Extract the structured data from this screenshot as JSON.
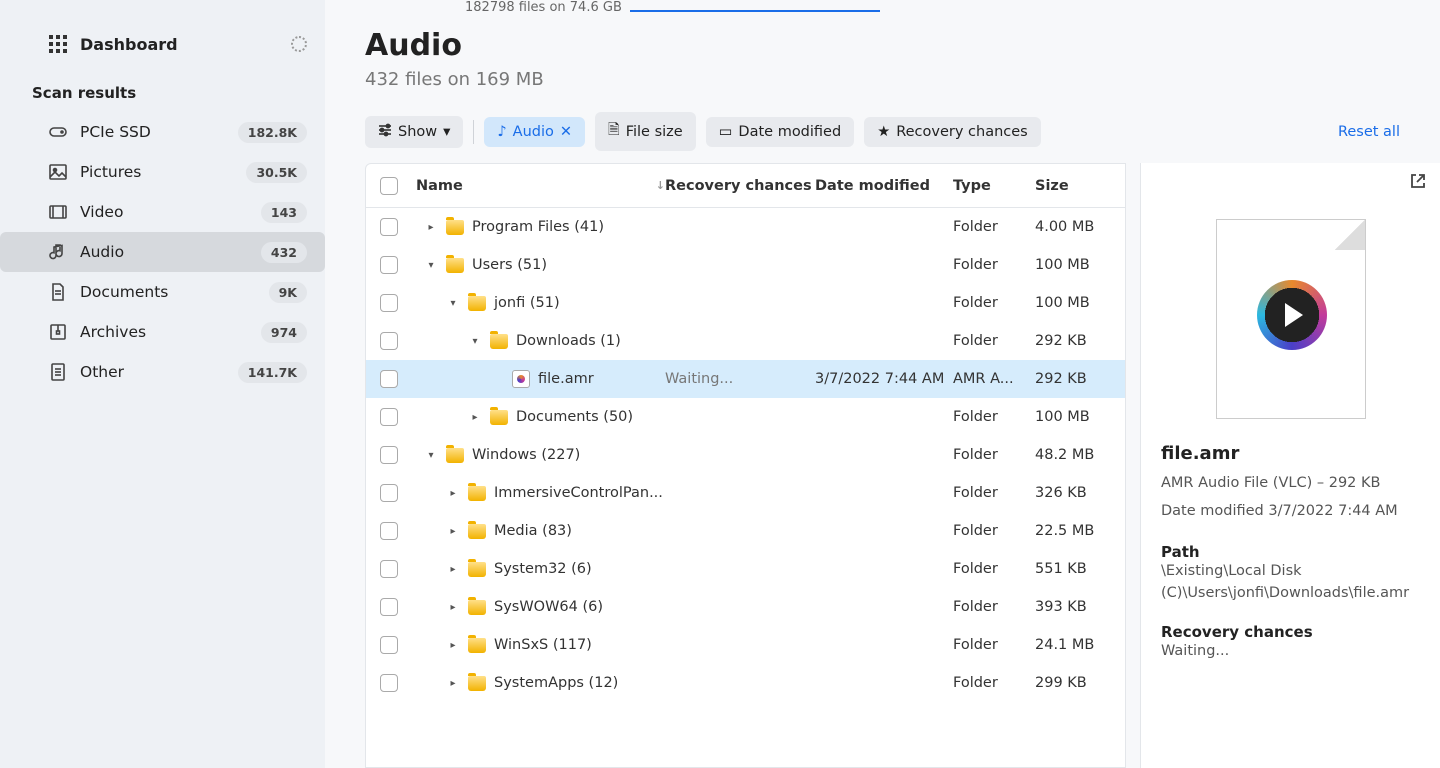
{
  "topbar": {
    "scan_progress": "182798 files on 74.6 GB"
  },
  "sidebar": {
    "dashboard": {
      "label": "Dashboard"
    },
    "section_label": "Scan results",
    "items": [
      {
        "icon": "drive-icon",
        "label": "PCIe SSD",
        "badge": "182.8K"
      },
      {
        "icon": "picture-icon",
        "label": "Pictures",
        "badge": "30.5K"
      },
      {
        "icon": "video-icon",
        "label": "Video",
        "badge": "143"
      },
      {
        "icon": "audio-icon",
        "label": "Audio",
        "badge": "432",
        "active": true
      },
      {
        "icon": "document-icon",
        "label": "Documents",
        "badge": "9K"
      },
      {
        "icon": "archive-icon",
        "label": "Archives",
        "badge": "974"
      },
      {
        "icon": "other-icon",
        "label": "Other",
        "badge": "141.7K"
      }
    ]
  },
  "page": {
    "title": "Audio",
    "subtitle": "432 files on 169 MB"
  },
  "filters": {
    "show": "Show",
    "audio": "Audio",
    "file_size": "File size",
    "date_modified": "Date modified",
    "recovery_chances": "Recovery chances",
    "reset": "Reset all"
  },
  "columns": {
    "name": "Name",
    "recovery": "Recovery chances",
    "date": "Date modified",
    "type": "Type",
    "size": "Size"
  },
  "rows": [
    {
      "indent": 0,
      "toggle": "right",
      "kind": "folder",
      "name": "Program Files (41)",
      "rc": "",
      "date": "",
      "type": "Folder",
      "size": "4.00 MB"
    },
    {
      "indent": 0,
      "toggle": "down",
      "kind": "folder",
      "name": "Users (51)",
      "rc": "",
      "date": "",
      "type": "Folder",
      "size": "100 MB"
    },
    {
      "indent": 1,
      "toggle": "down",
      "kind": "folder",
      "name": "jonfi (51)",
      "rc": "",
      "date": "",
      "type": "Folder",
      "size": "100 MB"
    },
    {
      "indent": 2,
      "toggle": "down",
      "kind": "folder",
      "name": "Downloads (1)",
      "rc": "",
      "date": "",
      "type": "Folder",
      "size": "292 KB"
    },
    {
      "indent": 3,
      "toggle": "",
      "kind": "file",
      "name": "file.amr",
      "rc": "Waiting...",
      "date": "3/7/2022 7:44 AM",
      "type": "AMR A...",
      "size": "292 KB",
      "selected": true
    },
    {
      "indent": 2,
      "toggle": "right",
      "kind": "folder",
      "name": "Documents (50)",
      "rc": "",
      "date": "",
      "type": "Folder",
      "size": "100 MB"
    },
    {
      "indent": 0,
      "toggle": "down",
      "kind": "folder",
      "name": "Windows (227)",
      "rc": "",
      "date": "",
      "type": "Folder",
      "size": "48.2 MB"
    },
    {
      "indent": 1,
      "toggle": "right",
      "kind": "folder",
      "name": "ImmersiveControlPan...",
      "rc": "",
      "date": "",
      "type": "Folder",
      "size": "326 KB"
    },
    {
      "indent": 1,
      "toggle": "right",
      "kind": "folder",
      "name": "Media (83)",
      "rc": "",
      "date": "",
      "type": "Folder",
      "size": "22.5 MB"
    },
    {
      "indent": 1,
      "toggle": "right",
      "kind": "folder",
      "name": "System32 (6)",
      "rc": "",
      "date": "",
      "type": "Folder",
      "size": "551 KB"
    },
    {
      "indent": 1,
      "toggle": "right",
      "kind": "folder",
      "name": "SysWOW64 (6)",
      "rc": "",
      "date": "",
      "type": "Folder",
      "size": "393 KB"
    },
    {
      "indent": 1,
      "toggle": "right",
      "kind": "folder",
      "name": "WinSxS (117)",
      "rc": "",
      "date": "",
      "type": "Folder",
      "size": "24.1 MB"
    },
    {
      "indent": 1,
      "toggle": "right",
      "kind": "folder",
      "name": "SystemApps (12)",
      "rc": "",
      "date": "",
      "type": "Folder",
      "size": "299 KB"
    }
  ],
  "details": {
    "filename": "file.amr",
    "meta1": "AMR Audio File (VLC) – 292 KB",
    "meta2": "Date modified 3/7/2022 7:44 AM",
    "path_label": "Path",
    "path_value": "\\Existing\\Local Disk (C)\\Users\\jonfi\\Downloads\\file.amr",
    "rc_label": "Recovery chances",
    "rc_value": "Waiting..."
  }
}
